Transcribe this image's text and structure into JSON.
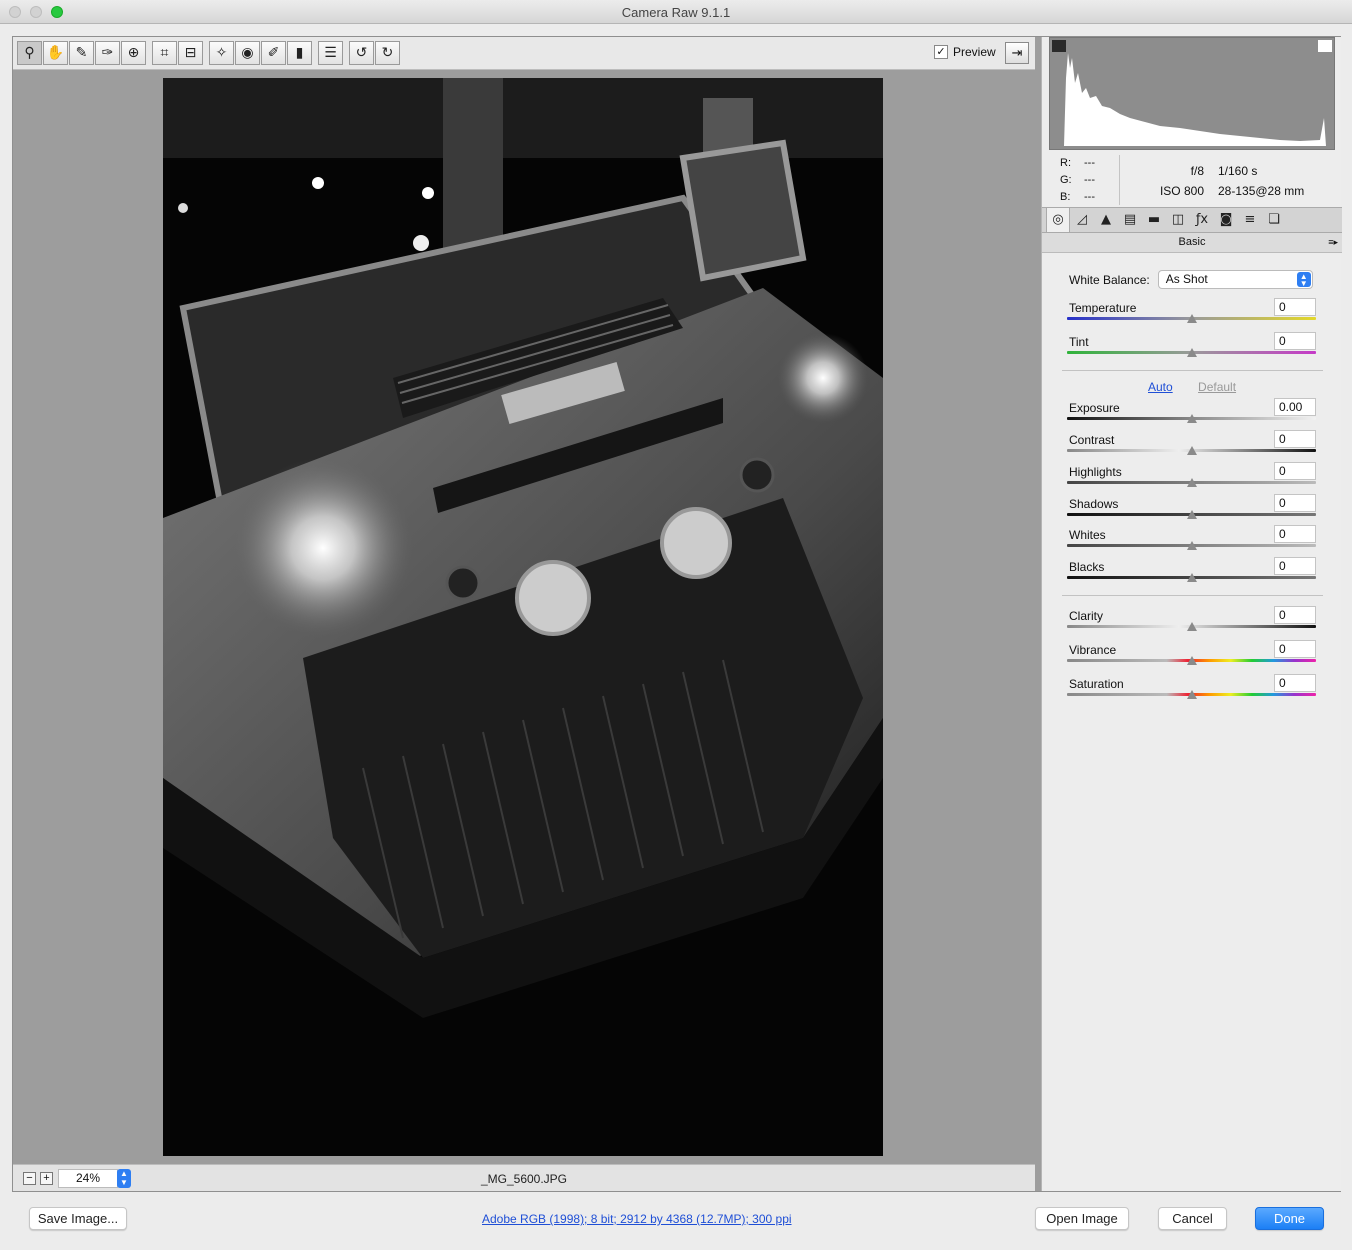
{
  "window": {
    "title": "Camera Raw 9.1.1"
  },
  "toolbar": {
    "tools": [
      {
        "name": "zoom-tool",
        "glyph": "⚲"
      },
      {
        "name": "hand-tool",
        "glyph": "✋"
      },
      {
        "name": "white-balance-tool",
        "glyph": "✎"
      },
      {
        "name": "color-sampler-tool",
        "glyph": "✑"
      },
      {
        "name": "targeted-adjustment-tool",
        "glyph": "⊕"
      },
      {
        "name": "crop-tool",
        "glyph": "⌗"
      },
      {
        "name": "straighten-tool",
        "glyph": "⊟"
      },
      {
        "name": "spot-removal-tool",
        "glyph": "✧"
      },
      {
        "name": "red-eye-tool",
        "glyph": "◉"
      },
      {
        "name": "adjustment-brush-tool",
        "glyph": "✐"
      },
      {
        "name": "graduated-filter-tool",
        "glyph": "▮"
      },
      {
        "name": "preferences-tool",
        "glyph": "☰"
      },
      {
        "name": "rotate-left-tool",
        "glyph": "↺"
      },
      {
        "name": "rotate-right-tool",
        "glyph": "↻"
      }
    ],
    "preview_label": "Preview",
    "preview_checked": "✓",
    "fullscreen_glyph": "⇥"
  },
  "status": {
    "zoom": "24%",
    "filename": "_MG_5600.JPG",
    "zoom_out": "−",
    "zoom_in": "+"
  },
  "histogram": {
    "r_label": "R:",
    "g_label": "G:",
    "b_label": "B:",
    "r": "---",
    "g": "---",
    "b": "---"
  },
  "exif": {
    "aperture": "f/8",
    "shutter": "1/160 s",
    "iso": "ISO 800",
    "lens": "28-135@28 mm"
  },
  "panel_tabs": [
    {
      "name": "basic-tab-icon",
      "glyph": "◎"
    },
    {
      "name": "tone-curve-tab-icon",
      "glyph": "◿"
    },
    {
      "name": "detail-tab-icon",
      "glyph": "▲"
    },
    {
      "name": "hsl-tab-icon",
      "glyph": "▤"
    },
    {
      "name": "split-toning-tab-icon",
      "glyph": "▬"
    },
    {
      "name": "lens-corrections-tab-icon",
      "glyph": "◫"
    },
    {
      "name": "effects-tab-icon",
      "glyph": "ƒx"
    },
    {
      "name": "camera-calibration-tab-icon",
      "glyph": "◙"
    },
    {
      "name": "presets-tab-icon",
      "glyph": "≡"
    },
    {
      "name": "snapshots-tab-icon",
      "glyph": "❏"
    }
  ],
  "panel": {
    "title": "Basic",
    "menu_glyph": "≡▸",
    "white_balance_label": "White Balance:",
    "white_balance_value": "As Shot",
    "auto_label": "Auto",
    "default_label": "Default",
    "sliders": [
      {
        "label": "Temperature",
        "value": "0",
        "level": 0.5,
        "gradient": "temp"
      },
      {
        "label": "Tint",
        "value": "0",
        "level": 0.5,
        "gradient": "tint"
      },
      {
        "label": "Exposure",
        "value": "0.00",
        "level": 0.5,
        "gradient": "exposure"
      },
      {
        "label": "Contrast",
        "value": "0",
        "level": 0.5,
        "gradient": "contrast"
      },
      {
        "label": "Highlights",
        "value": "0",
        "level": 0.5,
        "gradient": "tonal"
      },
      {
        "label": "Shadows",
        "value": "0",
        "level": 0.5,
        "gradient": "dark"
      },
      {
        "label": "Whites",
        "value": "0",
        "level": 0.5,
        "gradient": "tonal"
      },
      {
        "label": "Blacks",
        "value": "0",
        "level": 0.5,
        "gradient": "dark"
      },
      {
        "label": "Clarity",
        "value": "0",
        "level": 0.5,
        "gradient": "contrast"
      },
      {
        "label": "Vibrance",
        "value": "0",
        "level": 0.5,
        "gradient": "color"
      },
      {
        "label": "Saturation",
        "value": "0",
        "level": 0.5,
        "gradient": "color"
      }
    ]
  },
  "footer": {
    "save_label": "Save Image...",
    "info_link": "Adobe RGB (1998); 8 bit; 2912 by 4368 (12.7MP); 300 ppi",
    "open_label": "Open Image",
    "cancel_label": "Cancel",
    "done_label": "Done"
  }
}
